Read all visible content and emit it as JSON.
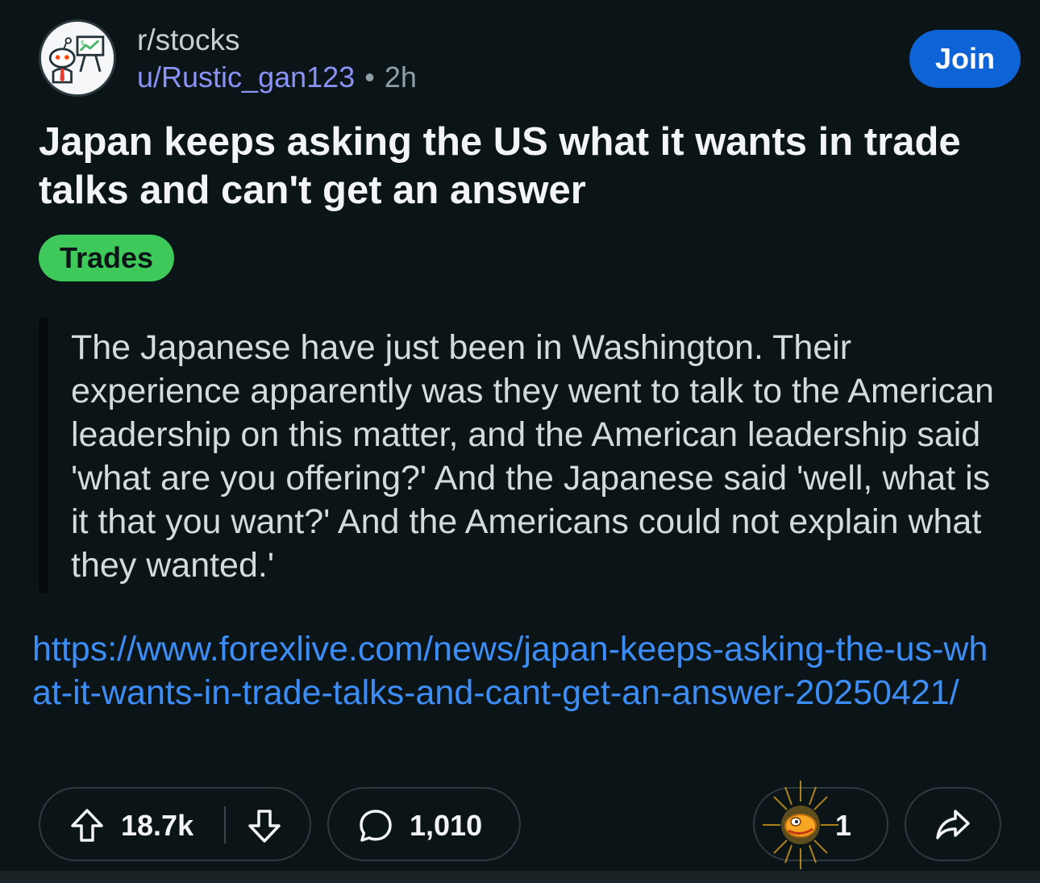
{
  "header": {
    "subreddit": "r/stocks",
    "username": "u/Rustic_gan123",
    "separator": "•",
    "time_ago": "2h",
    "join_label": "Join",
    "avatar_icon": "subreddit-snoo-chart-icon"
  },
  "post": {
    "title": "Japan keeps asking the US what it wants in trade talks and can't get an answer",
    "flair": "Trades",
    "flair_color": "#3ec95a",
    "quote": "The Japanese have just been in Washington. Their experience apparently was they went to talk to the American leadership on this matter, and the American leadership said 'what are you offering?' And the Japanese said 'well, what is it that you want?' And the Americans could not explain what they wanted.'",
    "link": "https://www.forexlive.com/news/japan-keeps-asking-the-us-what-it-wants-in-trade-talks-and-cant-get-an-answer-20250421/"
  },
  "actions": {
    "score": "18.7k",
    "comments": "1,010",
    "awards": "1",
    "upvote_icon": "arrow-up-icon",
    "downvote_icon": "arrow-down-icon",
    "comment_icon": "speech-bubble-icon",
    "award_icon": "award-icon",
    "share_icon": "share-arrow-icon"
  },
  "colors": {
    "background": "#0b1416",
    "join_button": "#0e63d6",
    "username": "#8a93f5",
    "link": "#3d8df6"
  }
}
